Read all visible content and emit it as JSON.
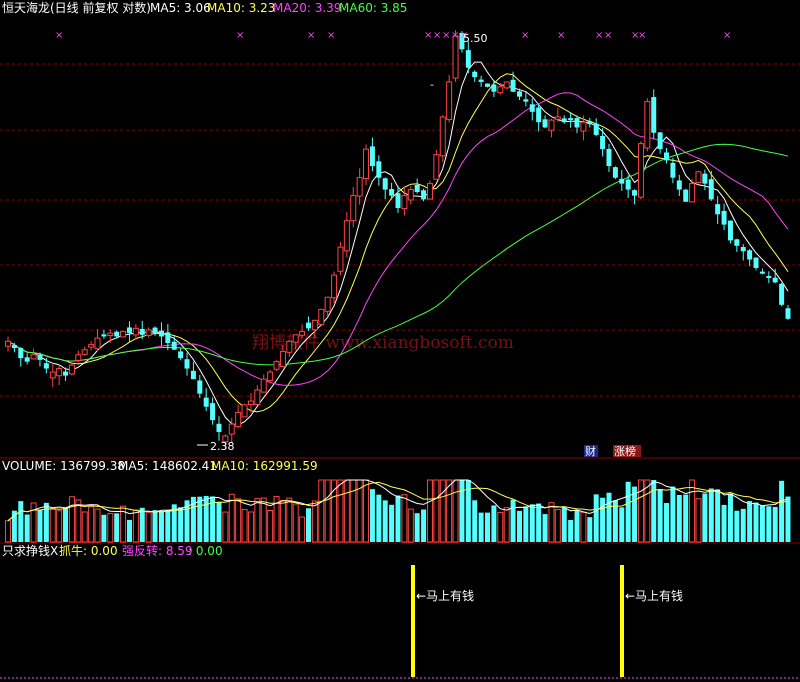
{
  "header": {
    "title": "恒天海龙(日线 前复权 对数)",
    "ma5": "MA5: 3.06",
    "ma10": "MA10: 3.23",
    "ma20": "MA20: 3.39",
    "ma60": "MA60: 3.85"
  },
  "price_panel": {
    "high_label": "5.50",
    "low_label": "2.38",
    "badge_cai": "财",
    "badge_zhangbang": "涨榜",
    "watermark": "翔博软件  www.xiangbosoft.com"
  },
  "volume_panel": {
    "volume": "VOLUME: 136799.38",
    "ma5": "MA5: 148602.41",
    "ma10": "MA10: 162991.59"
  },
  "indicator_panel": {
    "name": "只求挣钱X",
    "zhuaniu": "抓牛: 0.00",
    "qiangfanzhuan": "强反转: 8.59",
    "third": ": 0.00",
    "signal_label": "←马上有钱"
  },
  "colors": {
    "up": "#ff4444",
    "down": "#54ffff",
    "ma5": "#ffffff",
    "ma10": "#ffff54",
    "ma20": "#ff44ff",
    "ma60": "#44ff44",
    "grid": "#8b0000",
    "signal": "#ffff00"
  },
  "chart_data": [
    {
      "type": "candlestick",
      "name": "price",
      "scale": "log",
      "ylim": [
        2.38,
        5.5
      ],
      "highest": 5.5,
      "lowest": 2.38,
      "series_names": [
        "MA5",
        "MA10",
        "MA20",
        "MA60"
      ],
      "latest_ma": {
        "MA5": 3.06,
        "MA10": 3.23,
        "MA20": 3.39,
        "MA60": 3.85
      },
      "close": [
        2.92,
        2.88,
        2.82,
        2.8,
        2.84,
        2.81,
        2.76,
        2.74,
        2.76,
        2.72,
        2.78,
        2.84,
        2.87,
        2.9,
        2.94,
        2.95,
        2.97,
        2.95,
        2.98,
        2.97,
        3.0,
        2.96,
        2.99,
        2.97,
        2.95,
        2.91,
        2.87,
        2.82,
        2.76,
        2.7,
        2.62,
        2.55,
        2.48,
        2.42,
        2.4,
        2.46,
        2.52,
        2.56,
        2.58,
        2.64,
        2.7,
        2.74,
        2.8,
        2.86,
        2.92,
        2.96,
        2.98,
        3.0,
        3.05,
        3.12,
        3.2,
        3.35,
        3.55,
        3.75,
        3.95,
        4.1,
        4.35,
        4.2,
        4.1,
        4.0,
        3.95,
        3.85,
        3.95,
        4.0,
        3.98,
        3.92,
        4.05,
        4.3,
        4.65,
        5.0,
        5.5,
        5.35,
        5.15,
        5.05,
        5.0,
        4.95,
        4.9,
        4.95,
        5.0,
        4.9,
        4.85,
        4.8,
        4.7,
        4.6,
        4.55,
        4.62,
        4.65,
        4.6,
        4.62,
        4.55,
        4.6,
        4.58,
        4.48,
        4.35,
        4.2,
        4.1,
        4.05,
        4.0,
        3.95,
        4.4,
        4.8,
        4.5,
        4.35,
        4.25,
        4.1,
        4.0,
        3.9,
        4.05,
        4.15,
        4.05,
        3.92,
        3.8,
        3.72,
        3.6,
        3.56,
        3.52,
        3.46,
        3.4,
        3.36,
        3.33,
        3.3,
        3.15,
        3.06
      ]
    },
    {
      "type": "bar",
      "name": "volume",
      "latest": 136799.38,
      "latest_ma": {
        "MA5": 148602.41,
        "MA10": 162991.59
      }
    },
    {
      "type": "bar",
      "name": "只求挣钱X",
      "values": {
        "抓牛": 0.0,
        "强反转": 8.59,
        "third": 0.0
      },
      "signal_bars": 2
    }
  ]
}
